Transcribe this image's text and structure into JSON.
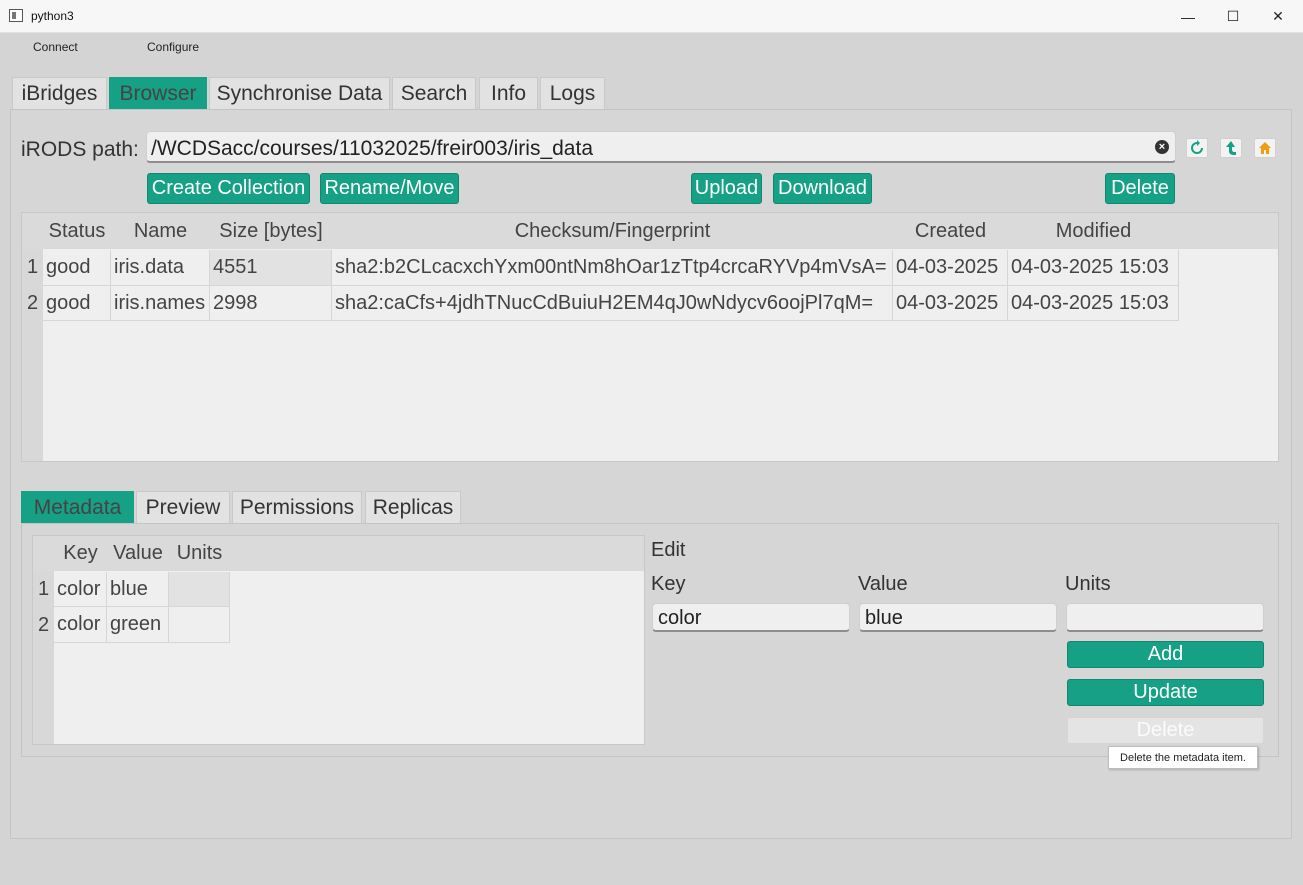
{
  "window": {
    "title": "python3",
    "minimize": "—",
    "maximize": "☐",
    "close": "✕"
  },
  "menu": [
    "Connect",
    "Configure"
  ],
  "tabs": [
    "iBridges",
    "Browser",
    "Synchronise Data",
    "Search",
    "Info",
    "Logs"
  ],
  "active_tab": "Browser",
  "browser": {
    "path_label": "iRODS path:",
    "path_value": "/WCDSacc/courses/11032025/freir003/iris_data",
    "clear_icon": "clear-icon",
    "buttons": {
      "create_collection": "Create Collection",
      "rename_move": "Rename/Move",
      "upload": "Upload",
      "download": "Download",
      "delete": "Delete"
    },
    "nav_icons": [
      "refresh-icon",
      "parent-folder-icon",
      "home-icon"
    ]
  },
  "file_table": {
    "columns": [
      "Status",
      "Name",
      "Size [bytes]",
      "Checksum/Fingerprint",
      "Created",
      "Modified"
    ],
    "rows": [
      {
        "num": "1",
        "status": "good",
        "name": "iris.data",
        "size": "4551",
        "checksum": "sha2:b2CLcacxchYxm00ntNm8hOar1zTtp4crcaRYVp4mVsA=",
        "created": "04-03-2025",
        "modified": "04-03-2025 15:03"
      },
      {
        "num": "2",
        "status": "good",
        "name": "iris.names",
        "size": "2998",
        "checksum": "sha2:caCfs+4jdhTNucCdBuiuH2EM4qJ0wNdycv6oojPl7qM=",
        "created": "04-03-2025",
        "modified": "04-03-2025 15:03"
      }
    ]
  },
  "lower_tabs": [
    "Metadata",
    "Preview",
    "Permissions",
    "Replicas"
  ],
  "active_lower_tab": "Metadata",
  "metadata_table": {
    "columns": [
      "Key",
      "Value",
      "Units"
    ],
    "rows": [
      {
        "num": "1",
        "key": "color",
        "value": "blue",
        "units": ""
      },
      {
        "num": "2",
        "key": "color",
        "value": "green",
        "units": ""
      }
    ]
  },
  "edit": {
    "title": "Edit",
    "key_label": "Key",
    "value_label": "Value",
    "units_label": "Units",
    "key_value": "color",
    "value_value": "blue",
    "units_value": "",
    "add": "Add",
    "update": "Update",
    "delete": "Delete"
  },
  "tooltip": "Delete the metadata item.",
  "colors": {
    "accent": "#16a085",
    "background": "#d4d4d4"
  }
}
